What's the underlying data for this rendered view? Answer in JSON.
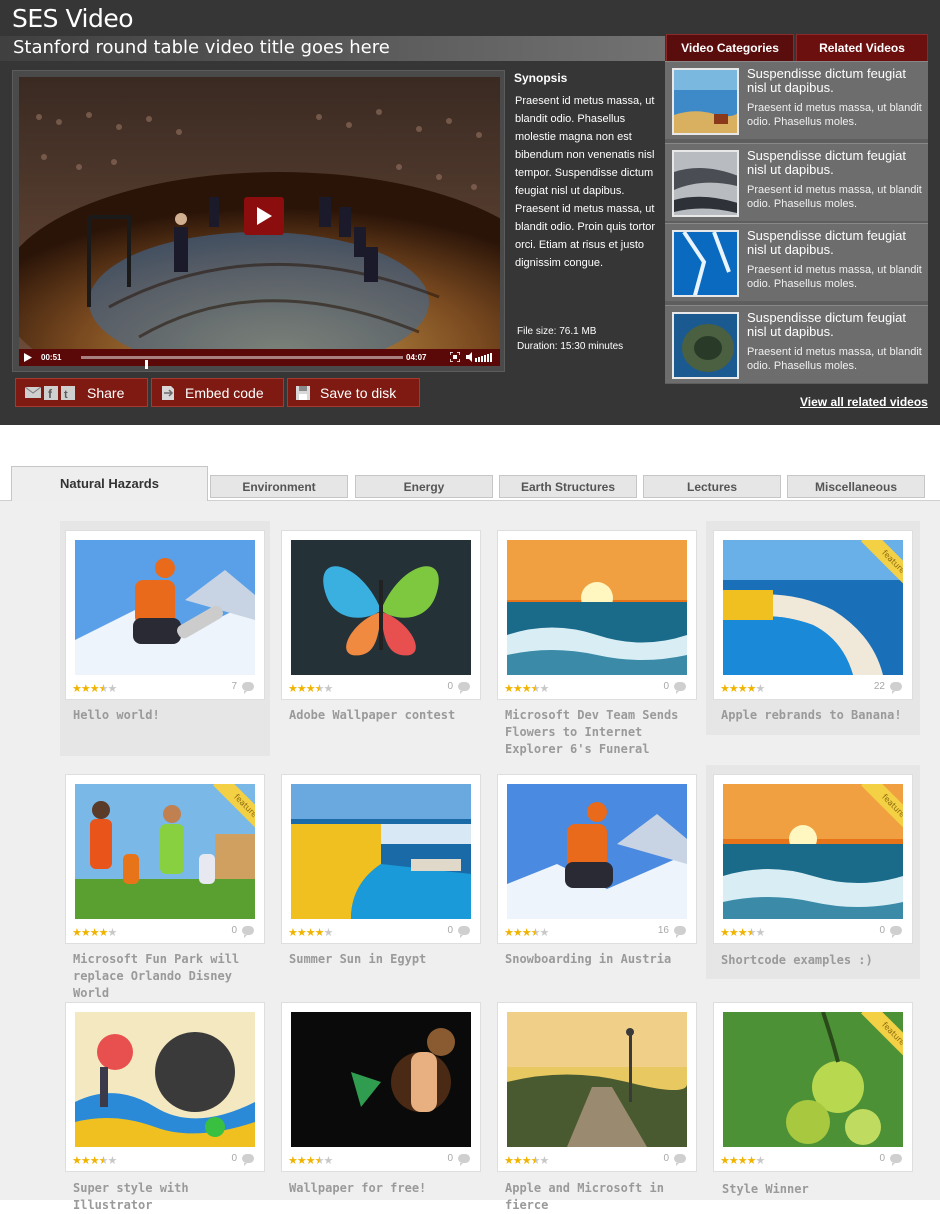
{
  "header": {
    "app_title": "SES Video",
    "video_title": "Stanford round table video title goes here"
  },
  "related_tabs": [
    "Video Categories",
    "Related Videos"
  ],
  "player": {
    "elapsed": "00:51",
    "total": "04:07",
    "progress": 0.2
  },
  "synopsis": {
    "heading": "Synopsis",
    "text": "Praesent id metus massa, ut blandit odio. Phasellus molestie magna non est bibendum non venenatis nisl tempor. Suspendisse dictum feugiat nisl ut dapibus. Praesent id metus massa, ut blandit odio. Proin quis tortor orci. Etiam at risus et justo dignissim congue.",
    "file_size": "File size: 76.1 MB",
    "duration": "Duration: 15:30 minutes"
  },
  "actions": {
    "share": "Share",
    "embed": "Embed code",
    "save": "Save to disk"
  },
  "related_videos": [
    {
      "title": "Suspendisse dictum feugiat nisl ut dapibus.",
      "desc": "Praesent id metus massa, ut blandit odio. Phasellus moles."
    },
    {
      "title": "Suspendisse dictum feugiat nisl ut dapibus.",
      "desc": "Praesent id metus massa, ut blandit odio. Phasellus moles."
    },
    {
      "title": "Suspendisse dictum feugiat nisl ut dapibus.",
      "desc": "Praesent id metus massa, ut blandit odio. Phasellus moles."
    },
    {
      "title": "Suspendisse dictum feugiat nisl ut dapibus.",
      "desc": "Praesent id metus massa, ut blandit odio. Phasellus moles."
    }
  ],
  "view_all": "View all related videos",
  "category_tabs": [
    "Natural Hazards",
    "Environment",
    "Energy",
    "Earth Structures",
    "Lectures",
    "Miscellaneous"
  ],
  "featured_label": "featured",
  "cards": [
    {
      "caption": "Hello world!",
      "rating": 3.5,
      "comments": "7",
      "featured": false
    },
    {
      "caption": "Adobe Wallpaper contest",
      "rating": 3.5,
      "comments": "0",
      "featured": false
    },
    {
      "caption": "Microsoft Dev Team Sends Flowers to Internet Explorer 6's Funeral",
      "rating": 3.5,
      "comments": "0",
      "featured": false
    },
    {
      "caption": "Apple rebrands to Banana!",
      "rating": 4,
      "comments": "22",
      "featured": true
    },
    {
      "caption": "Microsoft Fun Park will replace Orlando Disney World",
      "rating": 4,
      "comments": "0",
      "featured": true
    },
    {
      "caption": "Summer Sun in Egypt",
      "rating": 4,
      "comments": "0",
      "featured": false
    },
    {
      "caption": "Snowboarding in Austria",
      "rating": 3.5,
      "comments": "16",
      "featured": false
    },
    {
      "caption": "Shortcode examples :)",
      "rating": 3.5,
      "comments": "0",
      "featured": true
    },
    {
      "caption": "Super style with Illustrator",
      "rating": 3.5,
      "comments": "0",
      "featured": false
    },
    {
      "caption": "Wallpaper for free!",
      "rating": 3.5,
      "comments": "0",
      "featured": false
    },
    {
      "caption": "Apple and Microsoft in fierce",
      "rating": 3.5,
      "comments": "0",
      "featured": false
    },
    {
      "caption": "Style Winner",
      "rating": 4,
      "comments": "0",
      "featured": true
    }
  ],
  "colors": {
    "header_bg": "#363636",
    "accent_red": "#7e1a12",
    "star": "#f0b400"
  }
}
